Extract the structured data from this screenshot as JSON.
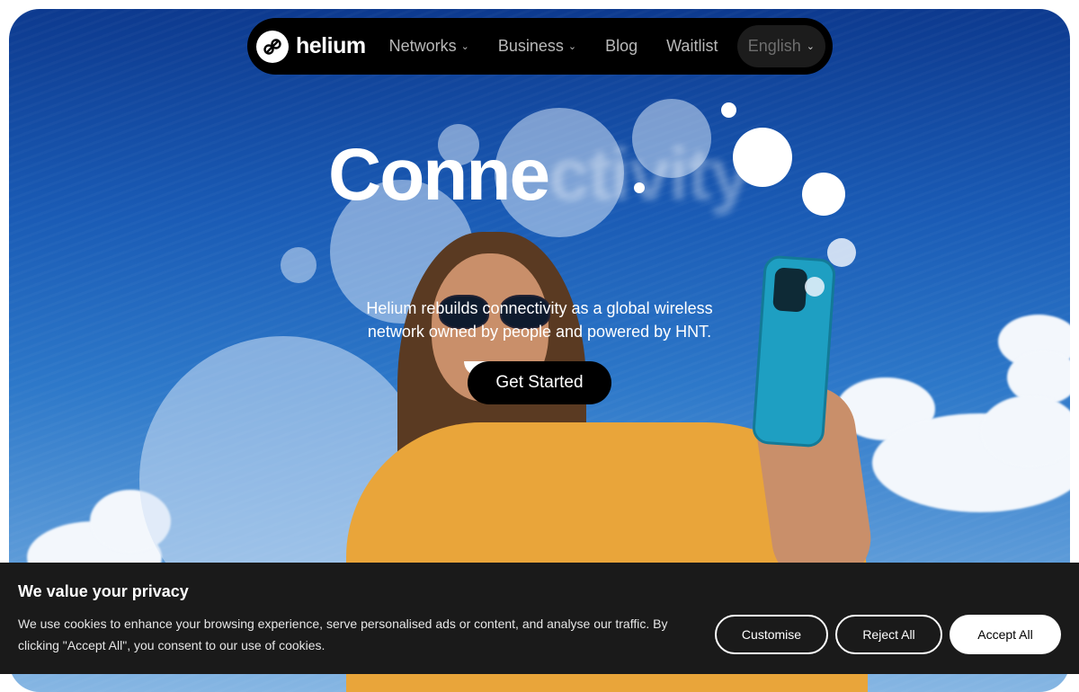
{
  "nav": {
    "brand": "helium",
    "items": [
      {
        "label": "Networks",
        "has_dropdown": true
      },
      {
        "label": "Business",
        "has_dropdown": true
      },
      {
        "label": "Blog",
        "has_dropdown": false
      },
      {
        "label": "Waitlist",
        "has_dropdown": false
      }
    ],
    "language": "English"
  },
  "hero": {
    "headline_solid": "Conne",
    "headline_faded": "ctivity",
    "tagline_line1": "Helium rebuilds connectivity as a global wireless",
    "tagline_line2": "network owned by people and powered by HNT.",
    "cta_label": "Get Started"
  },
  "cookie_banner": {
    "title": "We value your privacy",
    "text_line1": "We use cookies to enhance your browsing experience, serve personalised ads or content, and analyse our traffic. By",
    "text_line2": "clicking \"Accept All\", you consent to our use of cookies.",
    "customise_label": "Customise",
    "reject_label": "Reject All",
    "accept_label": "Accept All"
  },
  "colors": {
    "nav_bg": "#000000",
    "cookie_bg": "#1a1a1a",
    "hoodie": "#e9a53a",
    "phone": "#1e9fc2",
    "sky_top": "#0d3a8f"
  },
  "icons": {
    "logo": "helium-logo-icon",
    "dropdown": "chevron-down-icon"
  }
}
